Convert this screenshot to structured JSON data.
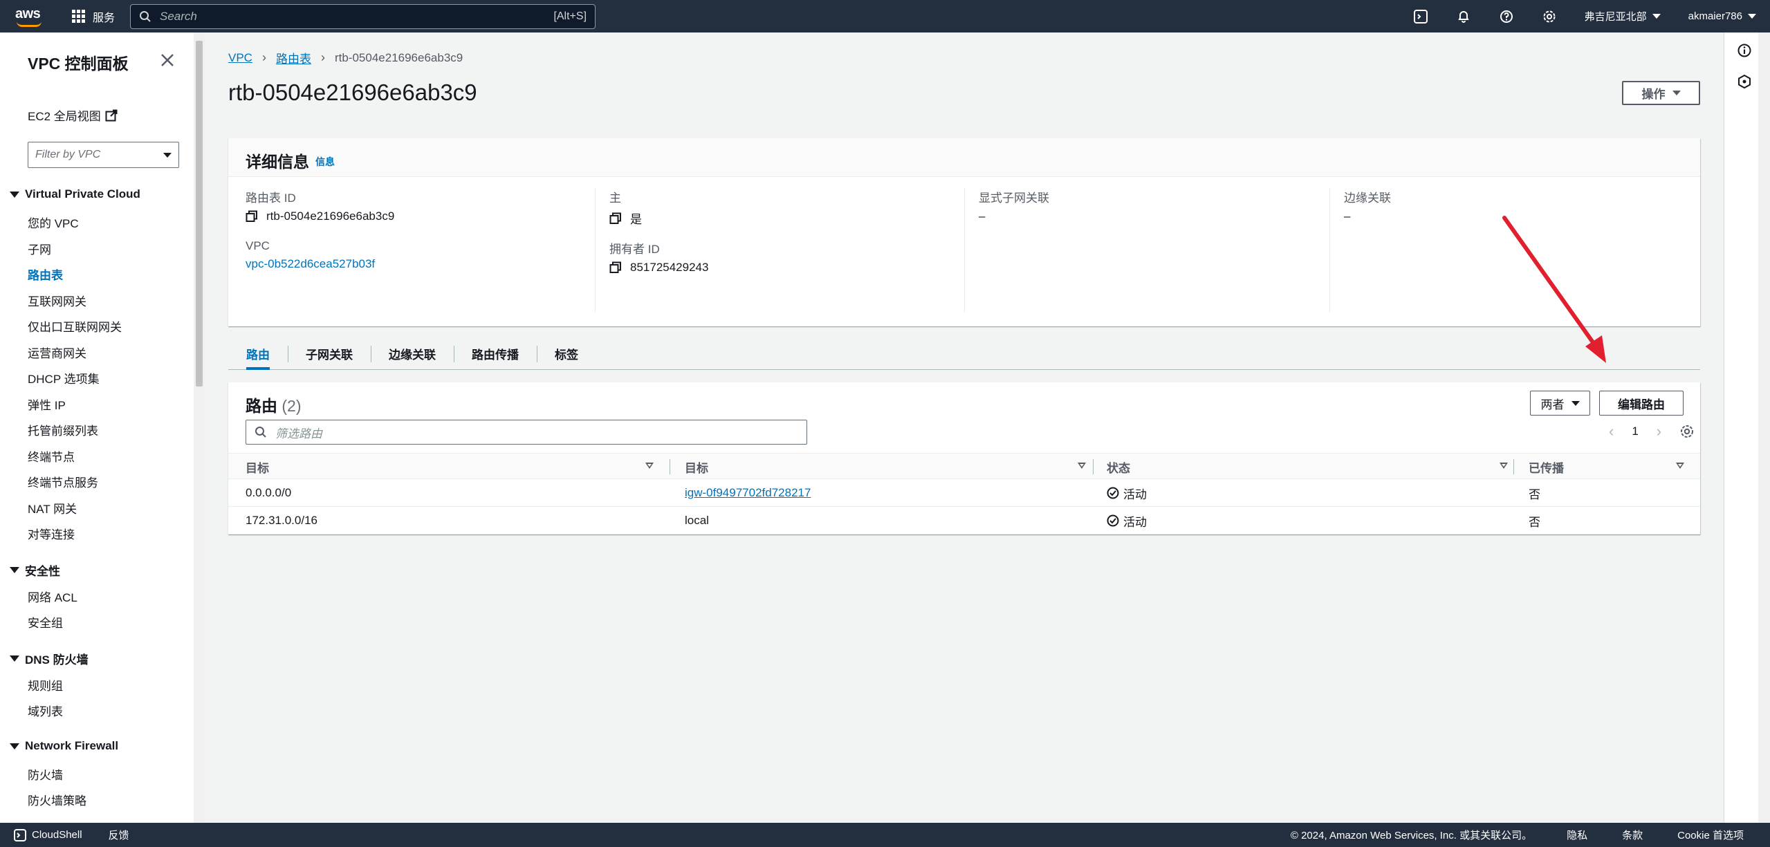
{
  "topnav": {
    "logo_text": "aws",
    "services_label": "服务",
    "search_placeholder": "Search",
    "search_shortcut": "[Alt+S]",
    "region": "弗吉尼亚北部",
    "user": "akmaier786"
  },
  "sidebar": {
    "title": "VPC 控制面板",
    "ec2_link": "EC2 全局视图",
    "filter_placeholder": "Filter by VPC",
    "sections": [
      {
        "title": "Virtual Private Cloud",
        "items": [
          "您的 VPC",
          "子网",
          "路由表",
          "互联网网关",
          "仅出口互联网网关",
          "运营商网关",
          "DHCP 选项集",
          "弹性 IP",
          "托管前缀列表",
          "终端节点",
          "终端节点服务",
          "NAT 网关",
          "对等连接"
        ]
      },
      {
        "title": "安全性",
        "items": [
          "网络 ACL",
          "安全组"
        ]
      },
      {
        "title": "DNS 防火墙",
        "items": [
          "规则组",
          "域列表"
        ]
      },
      {
        "title": "Network Firewall",
        "items": [
          "防火墙",
          "防火墙策略"
        ]
      }
    ],
    "active_item": "路由表"
  },
  "breadcrumb": {
    "root": "VPC",
    "parent": "路由表",
    "current": "rtb-0504e21696e6ab3c9"
  },
  "page": {
    "title": "rtb-0504e21696e6ab3c9",
    "actions_label": "操作"
  },
  "details": {
    "title": "详细信息",
    "info_label": "信息",
    "route_table_id_label": "路由表 ID",
    "route_table_id": "rtb-0504e21696e6ab3c9",
    "main_label": "主",
    "main_value": "是",
    "explicit_subnet_label": "显式子网关联",
    "explicit_subnet_value": "–",
    "edge_label": "边缘关联",
    "edge_value": "–",
    "vpc_label": "VPC",
    "vpc_value": "vpc-0b522d6cea527b03f",
    "owner_label": "拥有者 ID",
    "owner_value": "851725429243"
  },
  "tabs": [
    "路由",
    "子网关联",
    "边缘关联",
    "路由传播",
    "标签"
  ],
  "routes": {
    "title": "路由",
    "count": "(2)",
    "both_label": "两者",
    "edit_label": "编辑路由",
    "filter_placeholder": "筛选路由",
    "page": "1",
    "columns": [
      "目标",
      "目标",
      "状态",
      "已传播"
    ],
    "rows": [
      {
        "destination": "0.0.0.0/0",
        "target": "igw-0f9497702fd728217",
        "status": "活动",
        "propagated": "否"
      },
      {
        "destination": "172.31.0.0/16",
        "target": "local",
        "status": "活动",
        "propagated": "否"
      }
    ]
  },
  "footer": {
    "cloudshell": "CloudShell",
    "feedback": "反馈",
    "copyright": "© 2024, Amazon Web Services, Inc. 或其关联公司。",
    "privacy": "隐私",
    "terms": "条款",
    "cookie": "Cookie 首选项"
  },
  "colors": {
    "nav_bg": "#232f3e",
    "link": "#0073bb",
    "accent": "#ff9900",
    "annotation_arrow": "#e0202e"
  }
}
